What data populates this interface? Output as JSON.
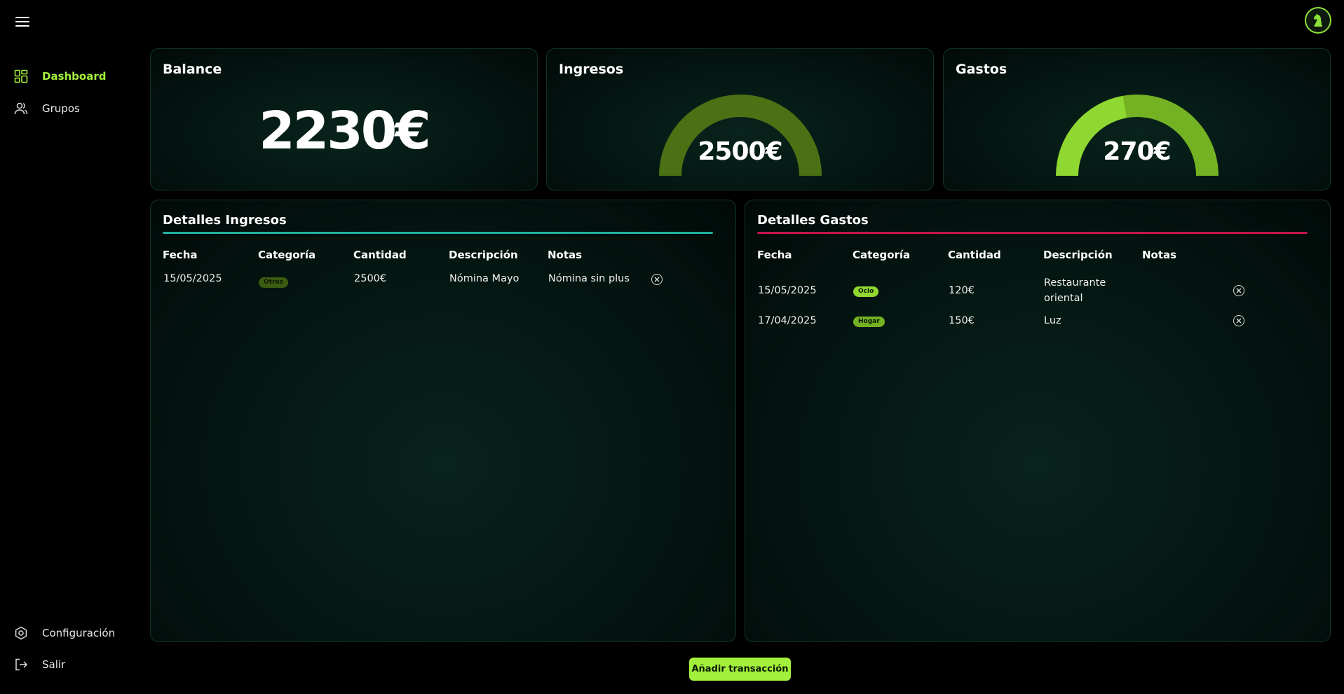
{
  "nav": {
    "dashboard": "Dashboard",
    "grupos": "Grupos",
    "configuracion": "Configuración",
    "salir": "Salir"
  },
  "balance": {
    "title": "Balance",
    "value": "2230€"
  },
  "ingresos": {
    "title": "Ingresos",
    "value": "2500€",
    "gauge_fill": 1.0,
    "color": "#4a7114"
  },
  "gastos": {
    "title": "Gastos",
    "value": "270€",
    "gauge_segments": [
      0.556,
      0.444
    ],
    "colors": [
      "#8fd831",
      "#74b223"
    ]
  },
  "detalles_ingresos": {
    "title": "Detalles Ingresos",
    "accent": "#20b2a0",
    "headers": [
      "Fecha",
      "Categoría",
      "Cantidad",
      "Descripción",
      "Notas"
    ],
    "rows": [
      {
        "fecha": "15/05/2025",
        "categoria": "Otros",
        "cantidad": "2500€",
        "descripcion": "Nómina Mayo",
        "notas": "Nómina sin plus"
      }
    ]
  },
  "detalles_gastos": {
    "title": "Detalles Gastos",
    "accent": "#c4164d",
    "headers": [
      "Fecha",
      "Categoría",
      "Cantidad",
      "Descripción",
      "Notas"
    ],
    "rows": [
      {
        "fecha": "15/05/2025",
        "categoria": "Ocio",
        "cantidad": "120€",
        "descripcion": "Restaurante oriental",
        "notas": ""
      },
      {
        "fecha": "17/04/2025",
        "categoria": "Hogar",
        "cantidad": "150€",
        "descripcion": "Luz",
        "notas": ""
      }
    ]
  },
  "add_button": "Añadir transacción"
}
